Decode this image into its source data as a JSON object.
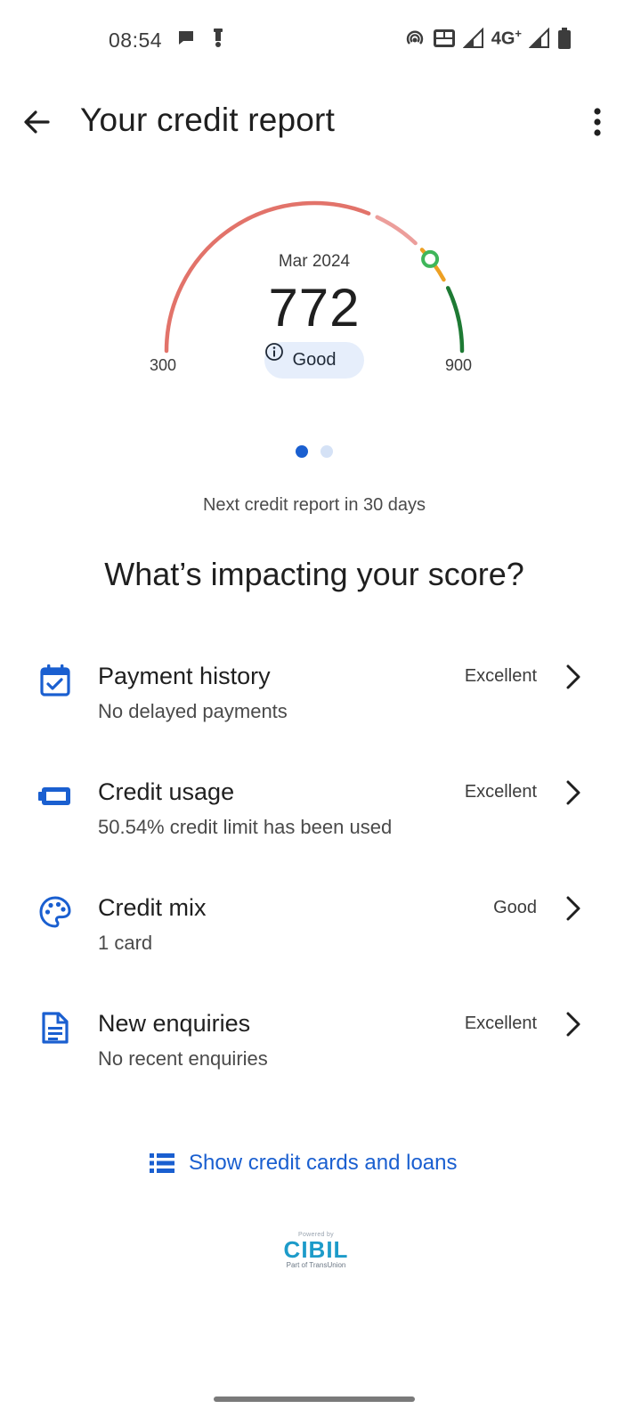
{
  "status_bar": {
    "time": "08:54",
    "network_label": "4G",
    "network_plus": "+"
  },
  "app_bar": {
    "title": "Your credit report"
  },
  "gauge": {
    "date": "Mar 2024",
    "score": "772",
    "min_label": "300",
    "max_label": "900",
    "min_value": 300,
    "max_value": 900,
    "score_value": 772,
    "rating": "Good"
  },
  "pager": {
    "total": 2,
    "active": 1
  },
  "next_report": "Next credit report in 30 days",
  "section_heading": "What’s impacting your score?",
  "factors": [
    {
      "title": "Payment history",
      "subtitle": "No delayed payments",
      "rating": "Excellent",
      "icon": "calendar-check-icon"
    },
    {
      "title": "Credit usage",
      "subtitle": "50.54% credit limit has been used",
      "rating": "Excellent",
      "icon": "battery-icon"
    },
    {
      "title": "Credit mix",
      "subtitle": "1 card",
      "rating": "Good",
      "icon": "palette-icon"
    },
    {
      "title": "New enquiries",
      "subtitle": "No recent enquiries",
      "rating": "Excellent",
      "icon": "document-icon"
    }
  ],
  "show_link": "Show credit cards and loans",
  "footer": {
    "powered_by": "Powered by",
    "brand": "CIBIL",
    "part_of": "Part of TransUnion"
  },
  "colors": {
    "accent": "#1a5fd0",
    "gauge_red": "#e2736a",
    "gauge_pink": "#ec9e9b",
    "gauge_orange": "#eda024",
    "gauge_green": "#1e7a34",
    "marker_green": "#3fb65a"
  }
}
